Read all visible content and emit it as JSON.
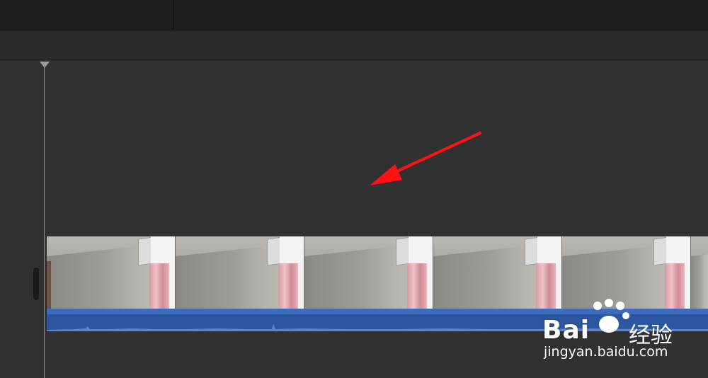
{
  "app": {
    "name": "video-timeline-editor"
  },
  "timeline": {
    "playhead_indicator": "playhead",
    "annotation": {
      "type": "arrow",
      "color": "#ff1010"
    },
    "clip": {
      "frames": [
        {
          "name": "frame-1"
        },
        {
          "name": "frame-2"
        },
        {
          "name": "frame-3"
        },
        {
          "name": "frame-4"
        },
        {
          "name": "frame-5"
        },
        {
          "name": "frame-6"
        }
      ],
      "audio_color": "#2c56a0"
    }
  },
  "watermark": {
    "brand": "Bai",
    "brand_suffix": "经验",
    "url": "jingyan.baidu.com"
  }
}
